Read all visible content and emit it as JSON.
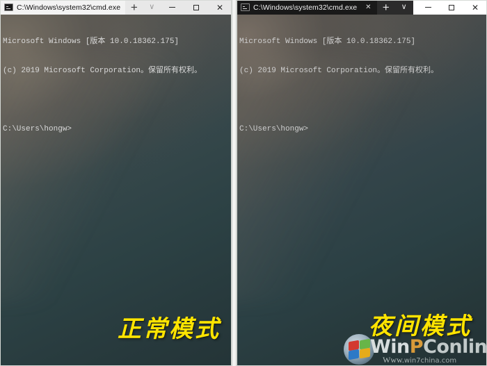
{
  "windows": [
    {
      "id": "normal",
      "mode_label": "正常模式",
      "theme": "light",
      "tab": {
        "icon": "cmd-icon",
        "title": "C:\\Windows\\system32\\cmd.exe",
        "close_label": "",
        "has_close": false
      },
      "tabbar": {
        "new_tab_label": "+",
        "dropdown_label": "∨"
      },
      "window_controls": {
        "minimize_label": "",
        "maximize_label": "",
        "close_label": "✕"
      },
      "console": {
        "line1": "Microsoft Windows [版本 10.0.18362.175]",
        "line2": "(c) 2019 Microsoft Corporation。保留所有权利。",
        "line3": "",
        "line4": "C:\\Users\\hongw>"
      }
    },
    {
      "id": "night",
      "mode_label": "夜间模式",
      "theme": "dark",
      "tab": {
        "icon": "cmd-icon",
        "title": "C:\\Windows\\system32\\cmd.exe",
        "close_label": "✕",
        "has_close": true
      },
      "tabbar": {
        "new_tab_label": "+",
        "dropdown_label": "∨"
      },
      "window_controls": {
        "minimize_label": "",
        "maximize_label": "",
        "close_label": "✕"
      },
      "console": {
        "line1": "Microsoft Windows [版本 10.0.18362.175]",
        "line2": "(c) 2019 Microsoft Corporation。保留所有权利。",
        "line3": "",
        "line4": "C:\\Users\\hongw>"
      }
    }
  ],
  "watermark": {
    "brand_win": "Win",
    "brand_p": "P",
    "brand_online": "Conline",
    "sub_www": "Www.",
    "sub_cn": "win7china.com"
  },
  "colors": {
    "caption_yellow": "#ffe400",
    "console_text": "#d9d9d9",
    "light_titlebar": "#e8e8e8",
    "dark_tab": "#191919"
  }
}
